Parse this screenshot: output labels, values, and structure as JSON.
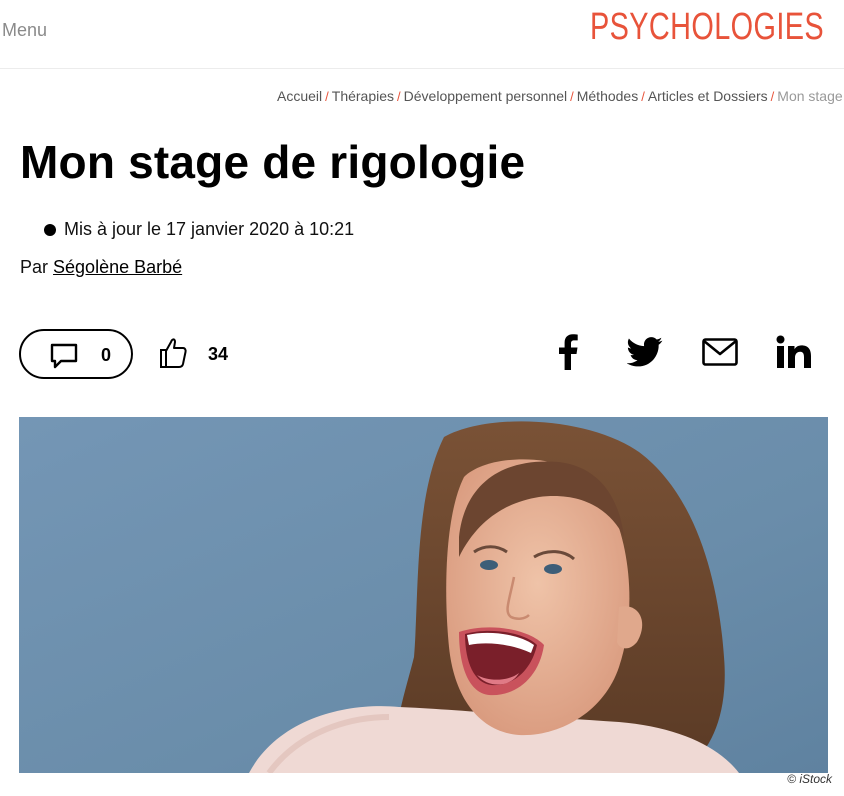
{
  "header": {
    "menu_label": "Menu",
    "logo_text": "PSYCHOLOGIES",
    "logo_color": "#e8533a"
  },
  "breadcrumb": {
    "items": [
      "Accueil",
      "Thérapies",
      "Développement personnel",
      "Méthodes",
      "Articles et Dossiers",
      "Mon stage de rigologie"
    ],
    "separator": "/"
  },
  "article": {
    "title": "Mon stage de rigologie",
    "updated": "Mis à jour le 17 janvier 2020 à 10:21",
    "byline_prefix": "Par",
    "author": "Ségolène Barbé"
  },
  "actions": {
    "comments_count": "0",
    "likes_count": "34",
    "share_icons": [
      "facebook-icon",
      "twitter-icon",
      "mail-icon",
      "linkedin-icon"
    ]
  },
  "image": {
    "credit": "© iStock",
    "background_color": "#6b8fae"
  }
}
